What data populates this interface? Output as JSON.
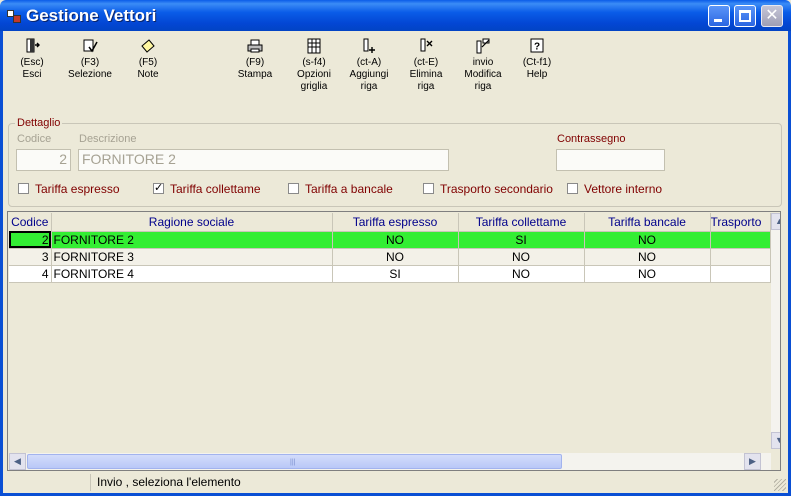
{
  "window": {
    "title": "Gestione Vettori"
  },
  "toolbar": [
    {
      "key": "(Esc)",
      "label": "Esci",
      "icon": "exit-door-icon"
    },
    {
      "key": "(F3)",
      "label": "Selezione",
      "icon": "selection-check-icon"
    },
    {
      "key": "(F5)",
      "label": "Note",
      "icon": "note-icon"
    },
    {
      "key": "(F9)",
      "label": "Stampa",
      "icon": "printer-icon"
    },
    {
      "key": "(s-f4)",
      "label": "Opzioni",
      "label2": "griglia",
      "icon": "grid-options-icon"
    },
    {
      "key": "(ct-A)",
      "label": "Aggiungi",
      "label2": "riga",
      "icon": "add-row-icon"
    },
    {
      "key": "(ct-E)",
      "label": "Elimina",
      "label2": "riga",
      "icon": "delete-row-icon"
    },
    {
      "key": "invio",
      "label": "Modifica",
      "label2": "riga",
      "icon": "edit-row-icon"
    },
    {
      "key": "(Ct-f1)",
      "label": "Help",
      "icon": "help-icon"
    }
  ],
  "detail": {
    "group_title": "Dettaglio",
    "codice_label": "Codice",
    "codice_value": "2",
    "descrizione_label": "Descrizione",
    "descrizione_value": "FORNITORE 2",
    "contrassegno_label": "Contrassegno",
    "contrassegno_value": "",
    "checkboxes": [
      {
        "label": "Tariffa espresso",
        "checked": false
      },
      {
        "label": "Tariffa collettame",
        "checked": true
      },
      {
        "label": "Tariffa a bancale",
        "checked": false
      },
      {
        "label": "Trasporto secondario",
        "checked": false
      },
      {
        "label": "Vettore interno",
        "checked": false
      }
    ]
  },
  "grid": {
    "columns": [
      "Codice",
      "Ragione sociale",
      "Tariffa espresso",
      "Tariffa collettame",
      "Tariffa bancale",
      "Trasporto"
    ],
    "rows": [
      {
        "codice": "2",
        "ragione": "FORNITORE 2",
        "espresso": "NO",
        "collettame": "SI",
        "bancale": "NO",
        "trasporto": "",
        "selected": true
      },
      {
        "codice": "3",
        "ragione": "FORNITORE 3",
        "espresso": "NO",
        "collettame": "NO",
        "bancale": "NO",
        "trasporto": "",
        "selected": false
      },
      {
        "codice": "4",
        "ragione": "FORNITORE 4",
        "espresso": "SI",
        "collettame": "NO",
        "bancale": "NO",
        "trasporto": "",
        "selected": false
      }
    ]
  },
  "status": {
    "text": "Invio , seleziona l'elemento"
  },
  "colors": {
    "selected_row": "#33ee33",
    "label_red": "#800000",
    "header_blue": "#00008b",
    "titlebar": "#0a5ce8"
  }
}
